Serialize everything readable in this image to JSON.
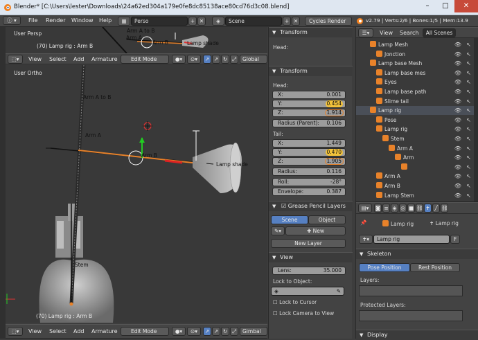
{
  "titlebar": {
    "title": "Blender* [C:\\Users\\lester\\Downloads\\24a62ed304a179e0fe8dc85138ace80cd76d3c08.blend]",
    "min": "–",
    "max": "□",
    "close": "✕"
  },
  "menubar": {
    "items": [
      "File",
      "Render",
      "Window",
      "Help"
    ],
    "screen": "Perso",
    "scene": "Scene",
    "engine": "Cycles Render",
    "stats": "v2.79 | Verts:2/6 | Bones:1/5 | Mem:13.9"
  },
  "top_viewport": {
    "view_name": "User Persp",
    "object_info": "(70) Lamp rig : Arm B",
    "labels": [
      "Arm A to B",
      "Arm A",
      "Arm B",
      "Lamp shade"
    ],
    "header": {
      "view": "View",
      "select": "Select",
      "add": "Add",
      "armature": "Armature",
      "mode": "Edit Mode",
      "orientation": "Global",
      "snap": "Closest"
    }
  },
  "main_viewport": {
    "view_name": "User Ortho",
    "object_info": "(70) Lamp rig : Arm B",
    "labels": [
      "Arm A to B",
      "Arm A",
      "Arm B",
      "Lamp shade",
      "Stem"
    ],
    "header": {
      "view": "View",
      "select": "Select",
      "add": "Add",
      "armature": "Armature",
      "mode": "Edit Mode",
      "orientation": "Gimbal",
      "snap": "Closest"
    }
  },
  "top_transform": {
    "title": "Transform",
    "head": "Head:"
  },
  "transform": {
    "title": "Transform",
    "head_label": "Head:",
    "head": [
      {
        "k": "X:",
        "v": "0.001"
      },
      {
        "k": "Y:",
        "v": "0.454"
      },
      {
        "k": "Z:",
        "v": "1.914"
      }
    ],
    "radius_parent": {
      "k": "Radius (Parent):",
      "v": "0.106"
    },
    "tail_label": "Tail:",
    "tail": [
      {
        "k": "X:",
        "v": "1.449"
      },
      {
        "k": "Y:",
        "v": "0.470"
      },
      {
        "k": "Z:",
        "v": "1.905"
      }
    ],
    "radius": {
      "k": "Radius:",
      "v": "0.116"
    },
    "roll": {
      "k": "Roll:",
      "v": "-28°"
    },
    "envelope": {
      "k": "Envelope:",
      "v": "0.387"
    }
  },
  "grease_pencil": {
    "title": "Grease Pencil Layers",
    "tab_scene": "Scene",
    "tab_object": "Object",
    "new": "New",
    "new_layer": "New Layer"
  },
  "view_panel": {
    "title": "View",
    "lens": {
      "k": "Lens:",
      "v": "35.000"
    },
    "lock_to_object": "Lock to Object:",
    "lock_to_cursor": "Lock to Cursor",
    "lock_camera": "Lock Camera to View"
  },
  "outliner": {
    "header": {
      "view": "View",
      "search": "Search",
      "filter": "All Scenes"
    },
    "rows": [
      {
        "indent": 0,
        "label": "Lamp Mesh"
      },
      {
        "indent": 1,
        "label": "Jonction"
      },
      {
        "indent": 0,
        "label": "Lamp base Mesh"
      },
      {
        "indent": 1,
        "label": "Lamp base mes"
      },
      {
        "indent": 1,
        "label": "Eyes"
      },
      {
        "indent": 1,
        "label": "Lamp base path"
      },
      {
        "indent": 1,
        "label": "Slime tail"
      },
      {
        "indent": 0,
        "label": "Lamp rig"
      },
      {
        "indent": 1,
        "label": "Pose"
      },
      {
        "indent": 1,
        "label": "Lamp rig"
      },
      {
        "indent": 2,
        "label": "Stem"
      },
      {
        "indent": 3,
        "label": "Arm A"
      },
      {
        "indent": 4,
        "label": "Arm"
      },
      {
        "indent": 5,
        "label": ""
      },
      {
        "indent": 1,
        "label": "Arm A"
      },
      {
        "indent": 1,
        "label": "Arm B"
      },
      {
        "indent": 1,
        "label": "Lamp Stem"
      }
    ]
  },
  "properties": {
    "breadcrumb_obj": "Lamp rig",
    "breadcrumb_data": "Lamp rig",
    "datablock": "Lamp rig",
    "fake_user": "F",
    "skeleton_title": "Skeleton",
    "pose_position": "Pose Position",
    "rest_position": "Rest Position",
    "layers": "Layers:",
    "protected_layers": "Protected Layers:",
    "display": "Display"
  },
  "colors": {
    "accent_blue": "#5680c2",
    "header": "#454545",
    "viewport": "#393939",
    "bone_orange": "#e8822a"
  }
}
